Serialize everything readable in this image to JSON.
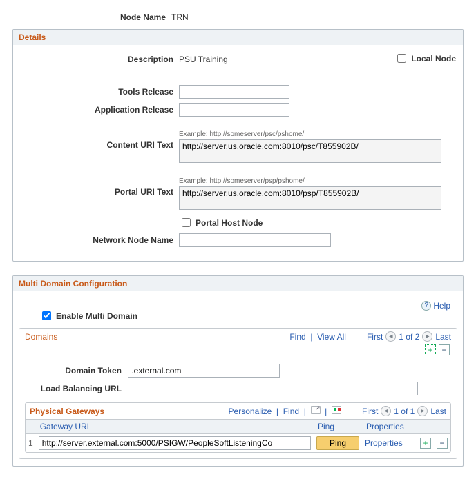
{
  "node": {
    "label": "Node Name",
    "value": "TRN"
  },
  "details": {
    "header": "Details",
    "description": {
      "label": "Description",
      "value": "PSU Training"
    },
    "local_node": {
      "label": "Local Node",
      "checked": false
    },
    "tools_release": {
      "label": "Tools Release",
      "value": ""
    },
    "app_release": {
      "label": "Application Release",
      "value": ""
    },
    "content_uri": {
      "label": "Content URI Text",
      "example": "Example: http://someserver/psc/pshome/",
      "value": "http://server.us.oracle.com:8010/psc/T855902B/"
    },
    "portal_uri": {
      "label": "Portal URI Text",
      "example": "Example: http://someserver/psp/pshome/",
      "value": "http://server.us.oracle.com:8010/psp/T855902B/"
    },
    "portal_host": {
      "label": "Portal Host Node",
      "checked": false
    },
    "network_node": {
      "label": "Network Node Name",
      "value": ""
    }
  },
  "mdc": {
    "header": "Multi Domain Configuration",
    "help": "Help",
    "enable": {
      "label": "Enable Multi Domain",
      "checked": true
    },
    "domains": {
      "title": "Domains",
      "find": "Find",
      "view_all": "View All",
      "nav": {
        "first": "First",
        "pos": "1 of 2",
        "last": "Last"
      },
      "domain_token": {
        "label": "Domain Token",
        "value": ".external.com"
      },
      "lb_url": {
        "label": "Load Balancing URL",
        "value": ""
      }
    },
    "gateways": {
      "title": "Physical Gateways",
      "personalize": "Personalize",
      "find": "Find",
      "nav": {
        "first": "First",
        "pos": "1 of 1",
        "last": "Last"
      },
      "cols": {
        "url": "Gateway URL",
        "ping": "Ping",
        "props": "Properties"
      },
      "rows": [
        {
          "n": "1",
          "url": "http://server.external.com:5000/PSIGW/PeopleSoftListeningCo",
          "ping_label": "Ping",
          "props_label": "Properties"
        }
      ]
    }
  }
}
